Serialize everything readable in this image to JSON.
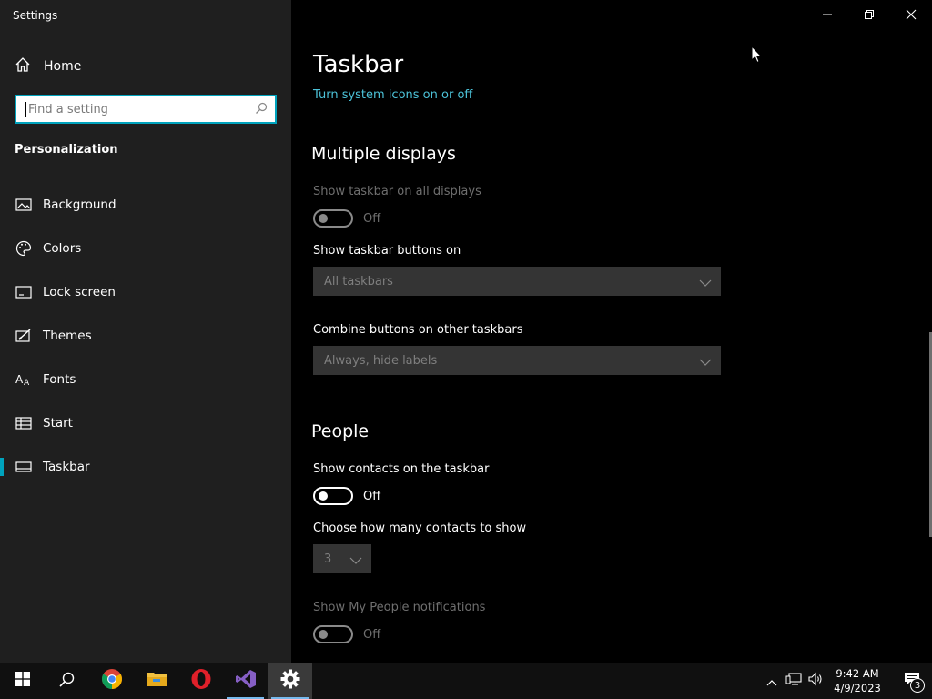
{
  "window": {
    "title": "Settings"
  },
  "sidebar": {
    "home_label": "Home",
    "search_placeholder": "Find a setting",
    "section_title": "Personalization",
    "items": [
      {
        "label": "Background",
        "icon": "picture-icon"
      },
      {
        "label": "Colors",
        "icon": "palette-icon"
      },
      {
        "label": "Lock screen",
        "icon": "lock-screen-icon"
      },
      {
        "label": "Themes",
        "icon": "themes-icon"
      },
      {
        "label": "Fonts",
        "icon": "fonts-icon"
      },
      {
        "label": "Start",
        "icon": "start-icon"
      },
      {
        "label": "Taskbar",
        "icon": "taskbar-icon",
        "selected": true
      }
    ]
  },
  "main": {
    "title": "Taskbar",
    "system_icons_link": "Turn system icons on or off",
    "multiple_displays": {
      "heading": "Multiple displays",
      "show_all_label": "Show taskbar on all displays",
      "show_all_state": "Off",
      "buttons_on_label": "Show taskbar buttons on",
      "buttons_on_value": "All taskbars",
      "combine_label": "Combine buttons on other taskbars",
      "combine_value": "Always, hide labels"
    },
    "people": {
      "heading": "People",
      "show_contacts_label": "Show contacts on the taskbar",
      "show_contacts_state": "Off",
      "contacts_count_label": "Choose how many contacts to show",
      "contacts_count_value": "3",
      "notifications_label": "Show My People notifications",
      "notifications_state": "Off"
    }
  },
  "taskbar": {
    "apps": [
      "windows-start",
      "search",
      "chrome",
      "file-explorer",
      "opera",
      "visual-studio",
      "settings"
    ],
    "time": "9:42 AM",
    "date": "4/9/2023",
    "notification_count": "3"
  },
  "colors": {
    "accent": "#00a3bd",
    "link": "#4cc2d8"
  }
}
